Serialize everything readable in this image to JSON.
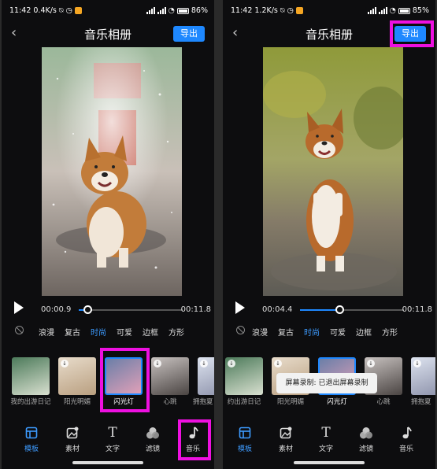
{
  "left": {
    "status": {
      "time": "11:42",
      "speed": "0.4K/s",
      "battery": "86"
    },
    "header": {
      "back": "‹",
      "title": "音乐相册",
      "export": "导出"
    },
    "player": {
      "current": "00:00.9",
      "end": "00:11.8",
      "progress": 0.08
    },
    "styles": [
      "浪漫",
      "复古",
      "时尚",
      "可爱",
      "边框",
      "方形"
    ],
    "active_style": 2,
    "templates": [
      "我的出游日记",
      "阳光明媚",
      "闪光灯",
      "心跳",
      "拥抱夏"
    ],
    "tabs": [
      "模板",
      "素材",
      "文字",
      "滤镜",
      "音乐"
    ]
  },
  "right": {
    "status": {
      "time": "11:42",
      "speed": "1.2K/s",
      "battery": "85"
    },
    "header": {
      "back": "‹",
      "title": "音乐相册",
      "export": "导出"
    },
    "player": {
      "current": "00:04.4",
      "end": "00:11.8",
      "progress": 0.38
    },
    "styles": [
      "浪漫",
      "复古",
      "时尚",
      "可爱",
      "边框",
      "方形"
    ],
    "active_style": 2,
    "templates": [
      "约出游日记",
      "阳光明媚",
      "闪光灯",
      "心跳",
      "拥抱夏"
    ],
    "toast": "屏幕录制: 已退出屏幕录制",
    "tabs": [
      "模板",
      "素材",
      "文字",
      "滤镜",
      "音乐"
    ]
  },
  "colors": {
    "accent": "#1e88ff",
    "highlight": "#ee10e0",
    "background": "#0d0d0f"
  }
}
